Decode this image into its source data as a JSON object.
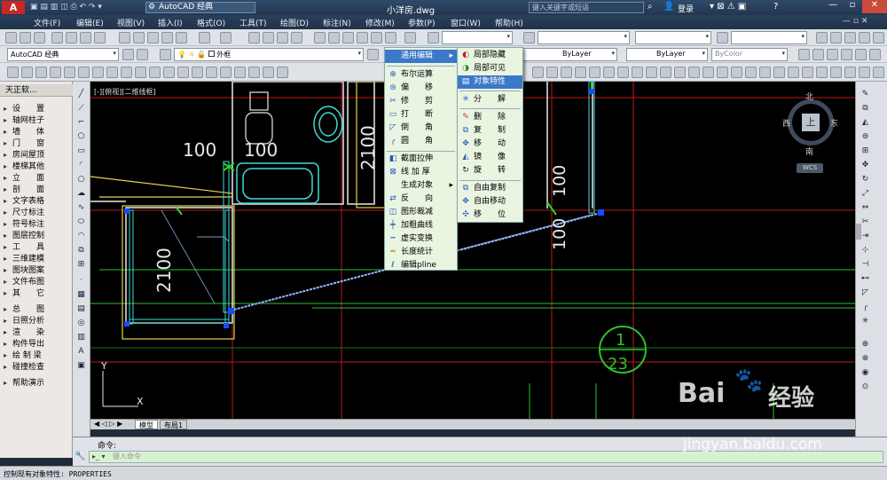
{
  "titlebar": {
    "workspace": "AutoCAD 经典",
    "filename": "小洋房.dwg",
    "search_placeholder": "键入关键字或短语",
    "login": "登录",
    "help_mark": "?"
  },
  "menubar": {
    "items": [
      "文件(F)",
      "编辑(E)",
      "视图(V)",
      "插入(I)",
      "格式(O)",
      "工具(T)",
      "绘图(D)",
      "标注(N)",
      "修改(M)",
      "参数(P)",
      "窗口(W)",
      "帮助(H)"
    ]
  },
  "toolbar2": {
    "workspace": "AutoCAD 经典",
    "layer": "外框",
    "bylayer1": "ByLayer",
    "bylayer2": "ByLayer",
    "bycolor": "ByColor"
  },
  "left_panel": {
    "title": "天正软...",
    "items": [
      "设　　置",
      "轴网柱子",
      "墙　　体",
      "门　　窗",
      "房间屋顶",
      "楼梯其他",
      "立　　面",
      "剖　　面",
      "文字表格",
      "尺寸标注",
      "符号标注",
      "图层控制",
      "工　　具",
      "三维建模",
      "图块图案",
      "文件布图",
      "其　　它",
      "总　　图",
      "日照分析",
      "渲　　染",
      "构件导出",
      "绘 制 梁",
      "碰撞检查",
      "帮助演示"
    ]
  },
  "viewport_label": "[-][俯视][二维线框]",
  "drawing": {
    "dims": [
      "100",
      "100",
      "2100",
      "100",
      "100",
      "2100"
    ],
    "tag_num": "1",
    "tag_den": "23",
    "axis_y": "Y",
    "axis_x": "X"
  },
  "viewcube": {
    "north": "北",
    "south": "南",
    "east": "东",
    "west": "西",
    "top": "上",
    "wcs": "WCS"
  },
  "popup_main": {
    "items": [
      "通用编辑",
      "布尔运算",
      "偏　　移",
      "修　　剪",
      "打　　断",
      "倒　　角",
      "圆　　角",
      "截面拉伸",
      "线 加 厚",
      "生成对象",
      "反　　向",
      "图形裁减",
      "加粗曲线",
      "虚实变换",
      "长度统计",
      "编辑pline"
    ]
  },
  "popup_sub": {
    "items": [
      "局部隐藏",
      "局部可见",
      "对象特性",
      "分　　解",
      "删　　除",
      "复　　制",
      "移　　动",
      "镜　　像",
      "旋　　转",
      "自由复制",
      "自由移动",
      "移　　位"
    ]
  },
  "tabs": {
    "model": "模型",
    "layout": "布局1"
  },
  "command": {
    "label": "命令:",
    "placeholder": "键入命令"
  },
  "status": {
    "text": "控制现有对象特性: PROPERTIES"
  },
  "watermark": {
    "brand": "Bai",
    "brand_cn": "经验",
    "url": "jingyan.baidu.com"
  }
}
